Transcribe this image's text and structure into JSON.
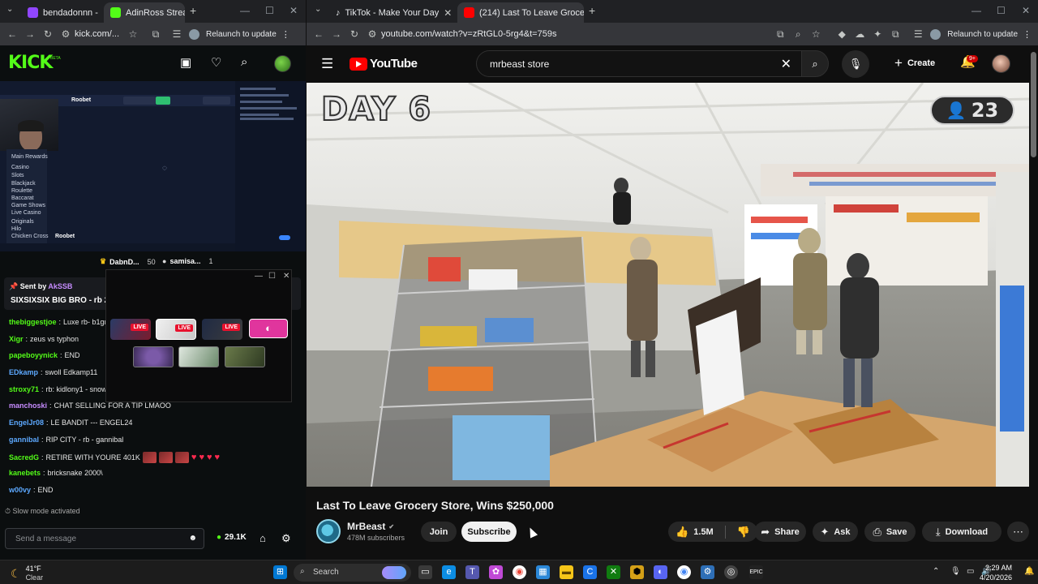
{
  "left_window": {
    "tabs": [
      {
        "label": "bendadonnn -",
        "active": false
      },
      {
        "label": "AdinRoss Strea",
        "active": true
      }
    ],
    "url": "kick.com/...",
    "relaunch": "Relaunch to update",
    "kick": {
      "logo": "KICK",
      "beta": "BETA",
      "stream_overlay": {
        "brand": "Roobet",
        "brand_footer": "Roobet",
        "side_items": [
          "Main Rewards",
          "Casino",
          "Slots",
          "Blackjack",
          "Roulette",
          "Baccarat",
          "Game Shows",
          "Live Casino",
          "Originals",
          "Hilo",
          "Chicken Cross"
        ]
      },
      "top_gifters": [
        {
          "name": "DabnD...",
          "count": "50",
          "icon": "crown-icon"
        },
        {
          "name": "samisa...",
          "count": "1",
          "icon": "medal-icon"
        }
      ],
      "pinned": {
        "sent_by_label": "Sent by",
        "user": "AkSSB",
        "message": "SIXSIXSIX BIG BRO - rb 29"
      },
      "chat": [
        {
          "user": "thebiggestjoe",
          "text": "Luxe rb- b1gn",
          "color": "#53fc18"
        },
        {
          "user": "Xigr",
          "text": "zeus vs typhon",
          "color": "#53fc18"
        },
        {
          "user": "papeboyynick",
          "text": "END",
          "color": "#53fc18"
        },
        {
          "user": "EDkamp",
          "text": "swoll Edkamp11",
          "color": "#5da9ff"
        },
        {
          "user": "stroxy71",
          "text": "rb: kidlony1 - snow",
          "color": "#53fc18"
        },
        {
          "user": "manchoski",
          "text": "CHAT SELLING FOR A TIP LMAOO",
          "color": "#c78cff"
        },
        {
          "user": "EngelJr08",
          "text": "LE BANDIT --- ENGEL24",
          "color": "#5da9ff"
        },
        {
          "user": "gannibal",
          "text": "RIP CITY - rb - gannibal",
          "color": "#5da9ff"
        },
        {
          "user": "SacredG",
          "text": "RETIRE WITH YOURE 401K",
          "color": "#53fc18"
        },
        {
          "user": "kanebets",
          "text": "bricksnake 2000\\",
          "color": "#53fc18"
        },
        {
          "user": "w00vy",
          "text": "END",
          "color": "#5da9ff"
        }
      ],
      "slow_mode": "Slow mode activated",
      "send_placeholder": "Send a message",
      "kicks_count": "29.1K"
    },
    "popup": {
      "live_label": "LIVE"
    }
  },
  "right_window": {
    "tabs": [
      {
        "label": "TikTok - Make Your Day",
        "active": false
      },
      {
        "label": "(214) Last To Leave Grocery",
        "active": true
      }
    ],
    "url": "youtube.com/watch?v=zRtGL0-5rg4&t=759s",
    "relaunch": "Relaunch to update",
    "youtube": {
      "logo": "YouTube",
      "search_value": "mrbeast store",
      "create_label": "Create",
      "notifications": "9+",
      "video": {
        "day_overlay": "DAY 6",
        "player_count": "23",
        "title": "Last To Leave Grocery Store, Wins $250,000"
      },
      "channel": {
        "name": "MrBeast",
        "subscribers": "478M subscribers"
      },
      "actions": {
        "join": "Join",
        "subscribe": "Subscribe",
        "likes": "1.5M",
        "share": "Share",
        "ask": "Ask",
        "save": "Save",
        "download": "Download"
      }
    }
  },
  "taskbar": {
    "weather_temp": "41°F",
    "weather_cond": "Clear",
    "search_label": "Search",
    "time": "2:29 AM",
    "date": "4/20/2026"
  },
  "colors": {
    "kick_green": "#53fc18",
    "youtube_red": "#ff0000",
    "live_red": "#e8112d",
    "discord_pink": "#e0359d"
  }
}
